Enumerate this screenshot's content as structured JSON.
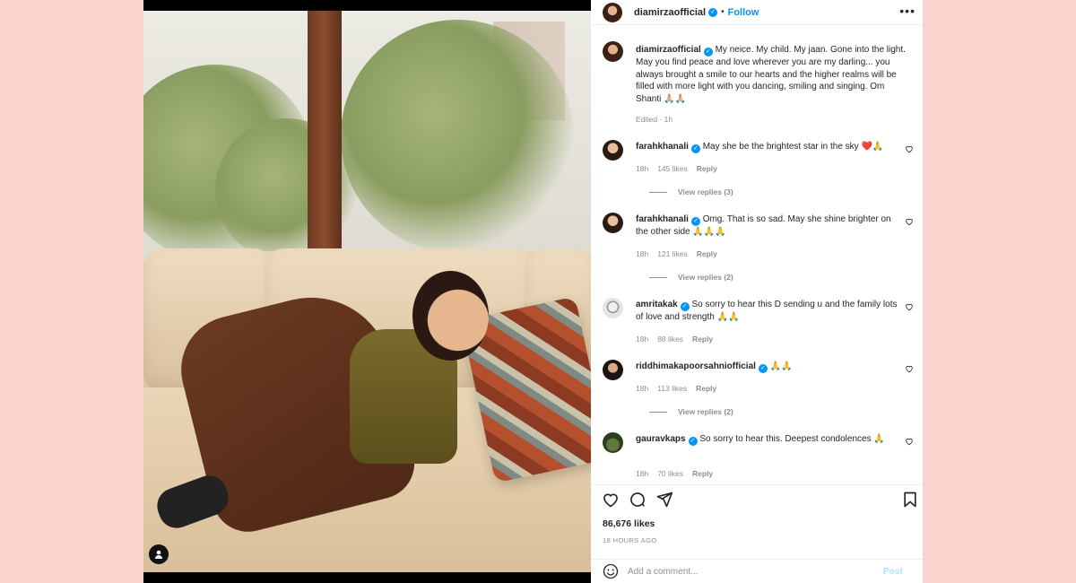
{
  "post": {
    "username": "diamirzaofficial",
    "follow_label": "Follow",
    "more_label": "•••",
    "verified_mark": "✓"
  },
  "caption": {
    "username": "diamirzaofficial",
    "text": "My neice. My child. My jaan. Gone into the light. May you find peace and love wherever you are my darling... you always brought a smile to our hearts and the higher realms will be filled with more light with you dancing, smiling and singing. Om Shanti 🙏🏼🙏🏼",
    "meta": "Edited · 1h"
  },
  "comments": [
    {
      "username": "farahkhanali",
      "text": "May she be the brightest star in the sky ❤️🙏",
      "time": "18h",
      "likes": "145 likes",
      "reply": "Reply",
      "view_replies": "View replies (3)"
    },
    {
      "username": "farahkhanali",
      "text": "Omg. That is so sad. May she shine brighter on the other side 🙏🙏🙏",
      "time": "18h",
      "likes": "121 likes",
      "reply": "Reply",
      "view_replies": "View replies (2)"
    },
    {
      "username": "amritakak",
      "text": "So sorry to hear this D sending u and the family lots of love and strength 🙏🙏",
      "time": "18h",
      "likes": "88 likes",
      "reply": "Reply"
    },
    {
      "username": "riddhimakapoorsahniofficial",
      "text": "🙏🙏",
      "time": "18h",
      "likes": "113 likes",
      "reply": "Reply",
      "view_replies": "View replies (2)"
    },
    {
      "username": "gauravkaps",
      "text": "So sorry to hear this. Deepest condolences 🙏",
      "time": "18h",
      "likes": "70 likes",
      "reply": "Reply"
    }
  ],
  "footer": {
    "likes": "86,676 likes",
    "time": "18 HOURS AGO",
    "comment_placeholder": "Add a comment...",
    "post_label": "Post"
  },
  "colors": {
    "accent": "#0095f6",
    "page_background": "#f9d4cf",
    "muted_text": "#8e8e8e"
  },
  "icons": [
    "user-tag-icon",
    "more-options-icon",
    "verified-badge-icon",
    "heart-icon",
    "comment-icon",
    "share-icon",
    "bookmark-icon",
    "emoji-icon"
  ]
}
